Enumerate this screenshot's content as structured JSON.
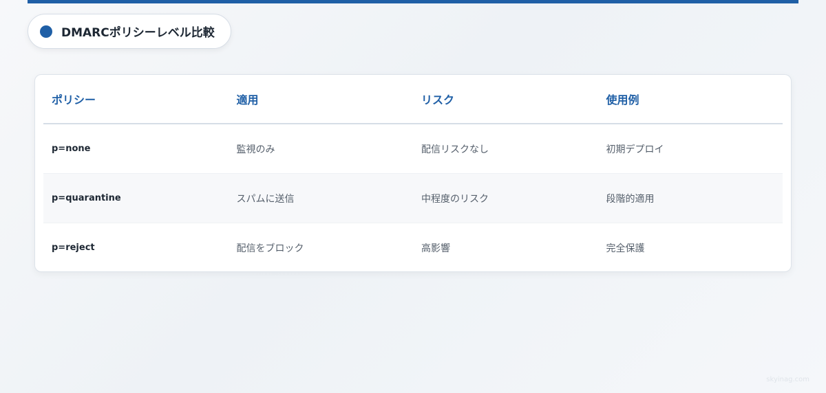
{
  "title": "DMARCポリシーレベル比較",
  "table": {
    "headers": [
      "ポリシー",
      "適用",
      "リスク",
      "使用例"
    ],
    "rows": [
      {
        "policy": "p=none",
        "application": "監視のみ",
        "risk": "配信リスクなし",
        "use_case": "初期デプロイ"
      },
      {
        "policy": "p=quarantine",
        "application": "スパムに送信",
        "risk": "中程度のリスク",
        "use_case": "段階的適用"
      },
      {
        "policy": "p=reject",
        "application": "配信をブロック",
        "risk": "高影響",
        "use_case": "完全保護"
      }
    ]
  },
  "watermark": "skyinag.com",
  "colors": {
    "accent": "#1f5fa6",
    "title_text": "#1d2733",
    "body_text": "#555f6b",
    "alt_row": "#f7f8fa"
  }
}
